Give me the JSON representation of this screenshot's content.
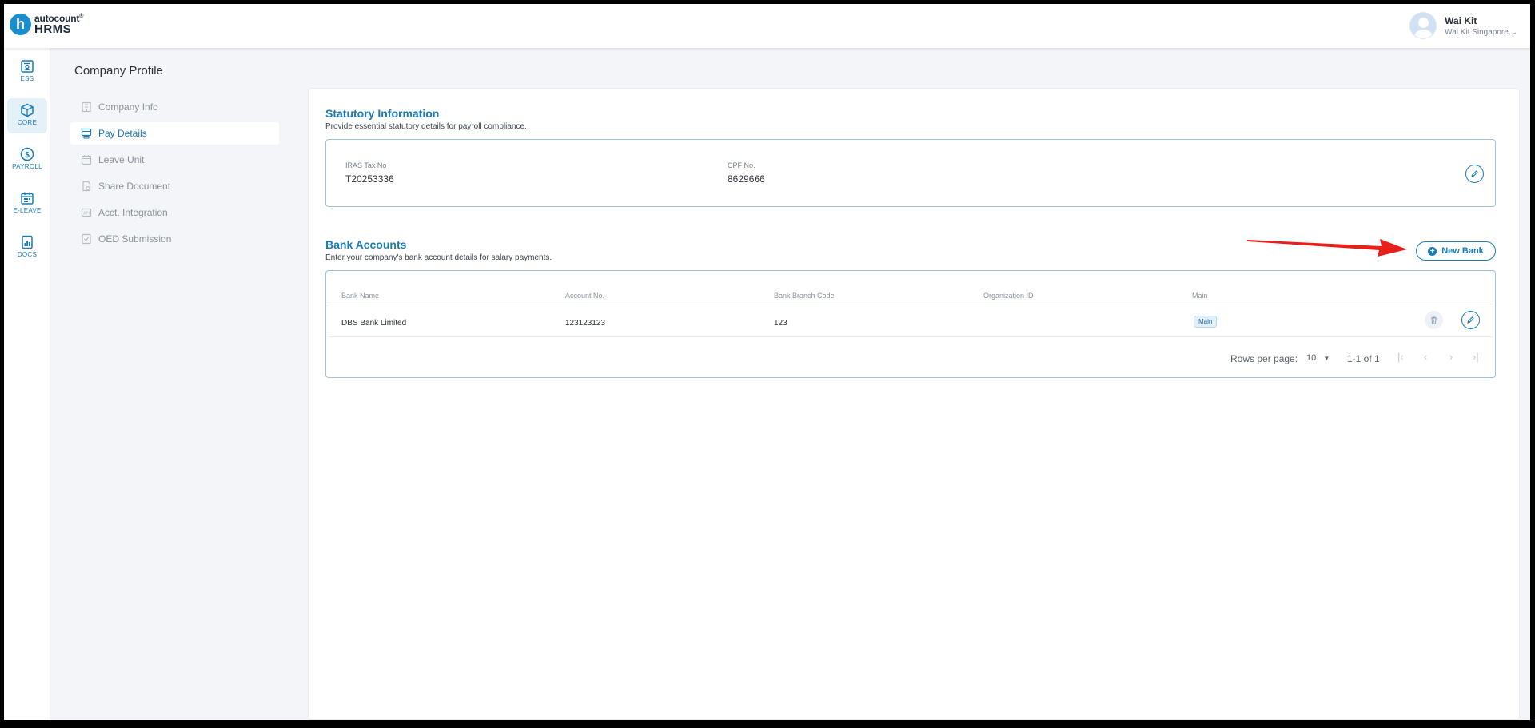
{
  "app": {
    "logo_badge": "h",
    "logo_top": "autocount",
    "logo_top_mark": "®",
    "logo_bottom": "HRMS"
  },
  "user": {
    "name": "Wai Kit",
    "company": "Wai Kit Singapore",
    "chevron": "⌄"
  },
  "rail": [
    {
      "label": "ESS",
      "icon": "ess-icon"
    },
    {
      "label": "CORE",
      "icon": "core-icon",
      "active": true
    },
    {
      "label": "PAYROLL",
      "icon": "payroll-icon"
    },
    {
      "label": "E-LEAVE",
      "icon": "calendar-icon"
    },
    {
      "label": "DOCS",
      "icon": "docs-icon"
    }
  ],
  "page": {
    "title": "Company Profile"
  },
  "subnav": [
    {
      "label": "Company Info",
      "icon": "building-icon"
    },
    {
      "label": "Pay Details",
      "icon": "pay-details-icon",
      "active": true
    },
    {
      "label": "Leave Unit",
      "icon": "leave-unit-icon"
    },
    {
      "label": "Share Document",
      "icon": "share-document-icon"
    },
    {
      "label": "Acct. Integration",
      "icon": "integration-icon"
    },
    {
      "label": "OED Submission",
      "icon": "submission-icon"
    }
  ],
  "statutory": {
    "title": "Statutory Information",
    "subtitle": "Provide essential statutory details for payroll compliance.",
    "iras_label": "IRAS Tax No",
    "iras_value": "T20253336",
    "cpf_label": "CPF No.",
    "cpf_value": "8629666"
  },
  "bank": {
    "title": "Bank Accounts",
    "subtitle": "Enter your company's bank account details for salary payments.",
    "new_button": "New Bank",
    "new_button_icon": "+",
    "columns": [
      "Bank Name",
      "Account No.",
      "Bank Branch Code",
      "Organization ID",
      "Main"
    ],
    "rows": [
      {
        "bank_name": "DBS Bank Limited",
        "account_no": "123123123",
        "branch_code": "123",
        "org_id": "",
        "main": "Main"
      }
    ],
    "pagination": {
      "rows_per_page_label": "Rows per page:",
      "rows_per_page": "10",
      "range": "1-1 of 1"
    }
  },
  "colors": {
    "accent": "#1a7bb9",
    "arrow": "#e8201c"
  }
}
